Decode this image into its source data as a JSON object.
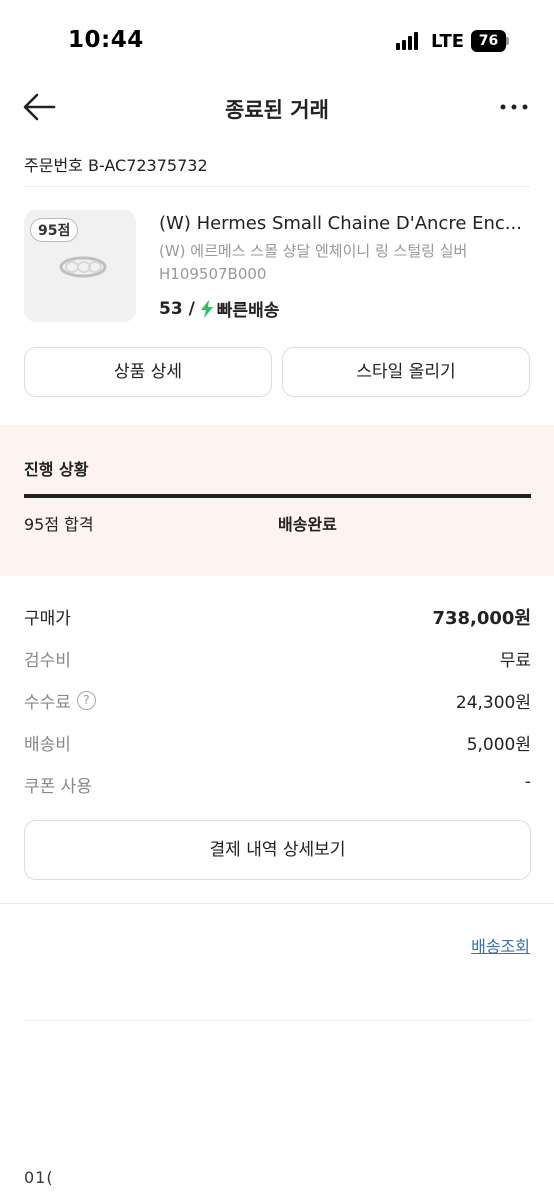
{
  "status_bar": {
    "time": "10:44",
    "network": "LTE",
    "battery": "76",
    "icons": [
      "signal-icon",
      "battery-icon"
    ]
  },
  "header": {
    "title": "종료된 거래",
    "back_icon": "arrow-left-icon",
    "more_icon": "more-horizontal-icon"
  },
  "order": {
    "number": "주문번호 B-AC72375732"
  },
  "product": {
    "grade_badge": "95점",
    "name": "(W) Hermes Small Chaine D'Ancre Enc...",
    "name_ko": "(W) 에르메스 스몰 샹달 엔체이니 링 스털링 실버",
    "code": "H109507B000",
    "size": "53 /",
    "shipping": "빠른배송",
    "shipping_icon": "lightning-bolt-icon",
    "bolt_color": "#22c55e"
  },
  "actions": {
    "product_detail": "상품 상세",
    "post_style": "스타일 올리기"
  },
  "progress": {
    "title": "진행 상황",
    "fill": 1.0,
    "steps": [
      "95점 합격",
      "배송완료"
    ]
  },
  "prices": [
    {
      "label": "구매가",
      "value": "738,000원"
    },
    {
      "label": "검수비",
      "value": "무료"
    },
    {
      "label": "수수료",
      "value": "24,300원",
      "help": "?"
    },
    {
      "label": "배송비",
      "value": "5,000원"
    },
    {
      "label": "쿠폰 사용",
      "value": "-"
    }
  ],
  "payment_detail_button": "결제 내역 상세보기",
  "tracking_link": "배송조회",
  "bottom_text": "01("
}
